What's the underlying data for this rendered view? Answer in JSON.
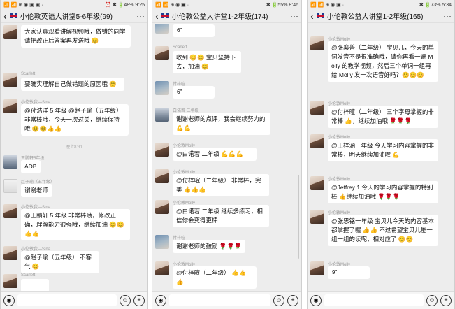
{
  "panels": [
    {
      "status_left": "📶 📶 ⊕ ◉ ▣ ▣ ·",
      "status_right": "⏰ ✱ 🔋48% 9:25",
      "title": "小伦敦英语大讲堂5-6年级(99)",
      "messages": [
        {
          "name": "",
          "text": "大家认真观看讲解视频哦，做错的同学请把改正后答案再发送哦 😊"
        },
        {
          "name": "Scarlett",
          "text": "要确实理解自己做错题的原因哦 😊"
        },
        {
          "name": "小伦敦我—Sina",
          "text": "@孙浩洋 5 年级 @赵子瑜（五年级）非常棒哦，今天一次过关，继续保持哦 😊😊👍👍"
        },
        {
          "name": "",
          "text": "晚上8:31"
        },
        {
          "name": "王鹏轩5年级",
          "text": "ADB"
        },
        {
          "name": "赵子瑜（五年级）",
          "text": "谢谢老师"
        },
        {
          "name": "小伦敦我—Sina",
          "text": "@王鹏轩 5 年级  非常棒哦，修改正确，理解能力很强哦，继续加油 😊😊👍👍"
        },
        {
          "name": "小伦敦我—Sina",
          "text": "@赵子瑜（五年级） 不客气 😊"
        },
        {
          "name": "Scarlett",
          "text": "…"
        }
      ]
    },
    {
      "status_left": "📶 📶 ⊕ ◉ ▣ ·",
      "status_right": "✱ 🔋55% 8:46",
      "title": "小伦敦公益大讲堂1-2年级(174)",
      "messages": [
        {
          "name": "",
          "text": "6\""
        },
        {
          "name": "Scarlett",
          "text": "收到 😊😊 宝贝坚持下去，加油 😊"
        },
        {
          "name": "付梓暄",
          "text": "6\""
        },
        {
          "name": "白诺若 二年级",
          "text": "谢谢老师的点评，我会继续努力的 💪💪"
        },
        {
          "name": "小伦敦Molly",
          "text": "@白诺若 二年级 💪💪💪"
        },
        {
          "name": "小伦敦Molly",
          "text": "@付梓暄（二年级） 非常棒，完美 👍👍👍"
        },
        {
          "name": "小伦敦Molly",
          "text": "@白诺若 二年级 继续多练习，相信你会变得更棒"
        },
        {
          "name": "付梓暄",
          "text": "谢谢老师的鼓励 🌹🌹🌹"
        },
        {
          "name": "小伦敦Molly",
          "text": "@付梓暄（二年级） 👍👍👍"
        }
      ]
    },
    {
      "status_left": "📶 📶 ⊕ ◉ ▣ ·",
      "status_right": "✱ 🔋73% 5:34",
      "title": "小伦敦公益大讲堂1-2年级(165)",
      "messages": [
        {
          "name": "小伦敦Molly",
          "text": "@张襄普（二年级） 宝贝儿，今天的单词发音不是很准确哦，请你再看一遍 Molly 的教学视频，然后三个单词一组再给 Molly 发一次语音好吗？😊😊😊"
        },
        {
          "name": "小伦敦Molly",
          "text": "@付梓暄（二年级） 三个字母掌握的非常棒 👍，继续加油哦 🌹🌹🌹"
        },
        {
          "name": "小伦敦Molly",
          "text": "@王梓涵一年级 今天学习内容掌握的非常棒，明天继续加油喔 💪"
        },
        {
          "name": "小伦敦Molly",
          "text": "@Jeffrey 1 今天的学习内容掌握的特别棒 👍继续加油哦 🌹🌹🌹"
        },
        {
          "name": "小伦敦Molly",
          "text": "@张思铭一年级 宝贝儿今天的内容基本都掌握了喔 👍👍 不过希望宝贝儿能一组一组的读呢，相对应了 😊😊"
        },
        {
          "name": "小伦敦Molly",
          "text": "9\""
        }
      ]
    }
  ],
  "input_bar": {
    "voice_icon": "◉",
    "emoji_icon": "☺",
    "plus_icon": "+"
  }
}
